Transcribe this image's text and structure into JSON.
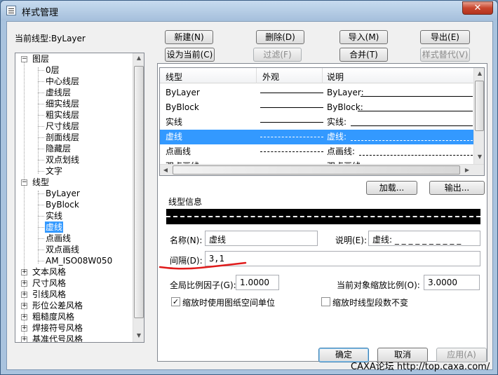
{
  "window": {
    "title": "样式管理",
    "close": "✕"
  },
  "current_linetype": "当前线型:ByLayer",
  "buttons": {
    "new": "新建(N)",
    "delete": "删除(D)",
    "import": "导入(M)",
    "export": "导出(E)",
    "set_current": "设为当前(C)",
    "filter": "过滤(F)",
    "merge": "合并(T)",
    "style_replace": "样式替代(V)",
    "load": "加载...",
    "output": "输出...",
    "ok": "确定",
    "cancel": "取消",
    "apply": "应用(A)"
  },
  "tree": {
    "layers_label": "图层",
    "layers": [
      "0层",
      "中心线层",
      "虚线层",
      "细实线层",
      "粗实线层",
      "尺寸线层",
      "剖面线层",
      "隐藏层",
      "双点划线",
      "文字"
    ],
    "linetype_label": "线型",
    "linetypes": [
      "ByLayer",
      "ByBlock",
      "实线",
      "虚线",
      "点画线",
      "双点画线",
      "AM_ISO08W050"
    ],
    "others": [
      "文本风格",
      "尺寸风格",
      "引线风格",
      "形位公差风格",
      "粗糙度风格",
      "焊接符号风格",
      "基准代号风格"
    ]
  },
  "list": {
    "headers": [
      "线型",
      "外观",
      "说明"
    ],
    "rows": [
      {
        "name": "ByLayer",
        "desc": "ByLayer:"
      },
      {
        "name": "ByBlock",
        "desc": "ByBlock:"
      },
      {
        "name": "实线",
        "desc": "实线:"
      },
      {
        "name": "虚线",
        "desc": "虚线:"
      },
      {
        "name": "点画线",
        "desc": "点画线:"
      },
      {
        "name": "双点画线",
        "desc": "双点画线:"
      }
    ]
  },
  "info": {
    "group_label": "线型信息",
    "name_label": "名称(N):",
    "name_value": "虚线",
    "desc_label": "说明(E):",
    "desc_value": "虚线: _ _ _ _ _ _ _ _ _ _",
    "interval_label": "间隔(D):",
    "interval_value": "3,1",
    "global_scale_label": "全局比例因子(G):",
    "global_scale_value": "1.0000",
    "object_scale_label": "当前对象缩放比例(O):",
    "object_scale_value": "3.0000",
    "paper_units_label": "缩放时使用图纸空间单位",
    "paper_units_checked": true,
    "keep_segments_label": "缩放时线型段数不变",
    "keep_segments_checked": false
  },
  "colors": {
    "accent": "#3399ff",
    "annotation": "#e01b1b"
  },
  "watermark": "CAXA论坛 http://top.caxa.com/"
}
